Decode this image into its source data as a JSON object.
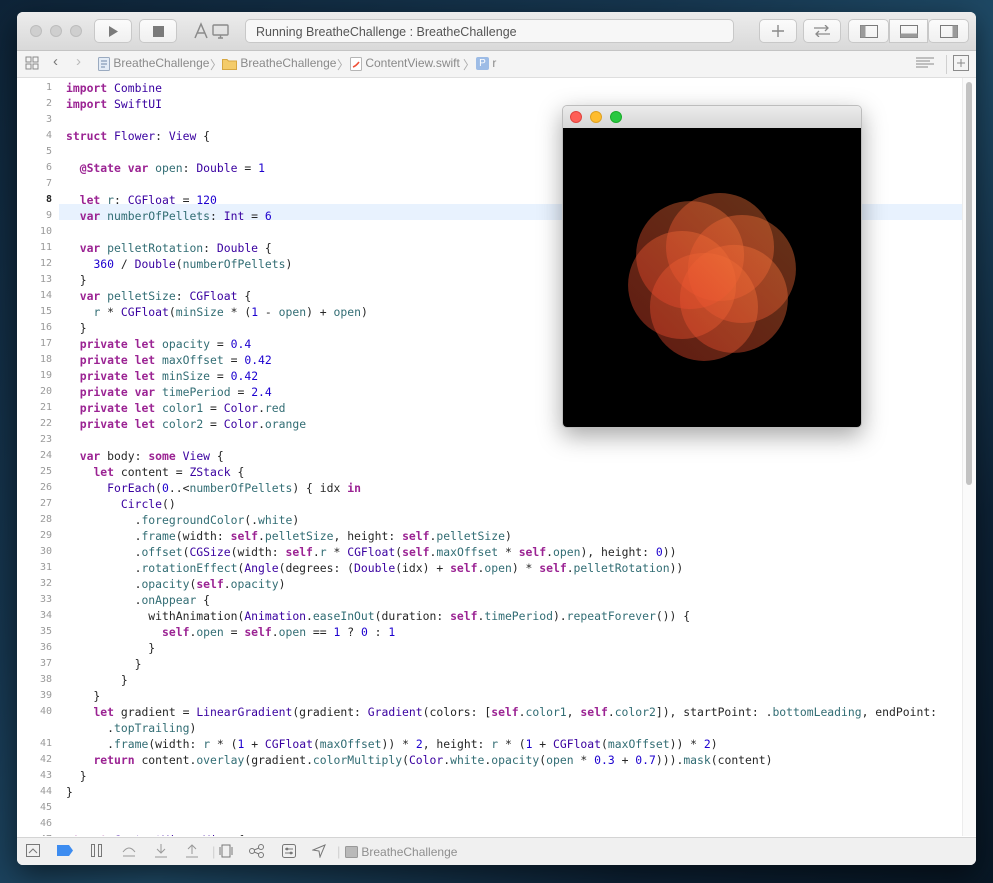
{
  "toolbar": {
    "status_text": "Running BreatheChallenge : BreatheChallenge",
    "icons": [
      "run-icon",
      "stop-icon",
      "scheme-icon",
      "library-add-icon",
      "code-review-icon",
      "navigator-toggle-icon",
      "debug-area-toggle-icon",
      "inspector-toggle-icon"
    ]
  },
  "jumpbar": {
    "crumbs": [
      "BreatheChallenge",
      "BreatheChallenge",
      "ContentView.swift",
      "r"
    ]
  },
  "editor": {
    "current_line": 8,
    "lines": [
      {
        "n": "1",
        "code": "import Combine"
      },
      {
        "n": "2",
        "code": "import SwiftUI"
      },
      {
        "n": "3",
        "code": ""
      },
      {
        "n": "4",
        "code": "struct Flower: View {"
      },
      {
        "n": "5",
        "code": ""
      },
      {
        "n": "6",
        "code": "  @State var open: Double = 1"
      },
      {
        "n": "7",
        "code": ""
      },
      {
        "n": "8",
        "code": "  let r: CGFloat = 120"
      },
      {
        "n": "9",
        "code": "  var numberOfPellets: Int = 6"
      },
      {
        "n": "10",
        "code": ""
      },
      {
        "n": "11",
        "code": "  var pelletRotation: Double {"
      },
      {
        "n": "12",
        "code": "    360 / Double(numberOfPellets)"
      },
      {
        "n": "13",
        "code": "  }"
      },
      {
        "n": "14",
        "code": "  var pelletSize: CGFloat {"
      },
      {
        "n": "15",
        "code": "    r * CGFloat(minSize * (1 - open) + open)"
      },
      {
        "n": "16",
        "code": "  }"
      },
      {
        "n": "17",
        "code": "  private let opacity = 0.4"
      },
      {
        "n": "18",
        "code": "  private let maxOffset = 0.42"
      },
      {
        "n": "19",
        "code": "  private let minSize = 0.42"
      },
      {
        "n": "20",
        "code": "  private var timePeriod = 2.4"
      },
      {
        "n": "21",
        "code": "  private let color1 = Color.red"
      },
      {
        "n": "22",
        "code": "  private let color2 = Color.orange"
      },
      {
        "n": "23",
        "code": ""
      },
      {
        "n": "24",
        "code": "  var body: some View {"
      },
      {
        "n": "25",
        "code": "    let content = ZStack {"
      },
      {
        "n": "26",
        "code": "      ForEach(0..<numberOfPellets) { idx in"
      },
      {
        "n": "27",
        "code": "        Circle()"
      },
      {
        "n": "28",
        "code": "          .foregroundColor(.white)"
      },
      {
        "n": "29",
        "code": "          .frame(width: self.pelletSize, height: self.pelletSize)"
      },
      {
        "n": "30",
        "code": "          .offset(CGSize(width: self.r * CGFloat(self.maxOffset * self.open), height: 0))"
      },
      {
        "n": "31",
        "code": "          .rotationEffect(Angle(degrees: (Double(idx) + self.open) * self.pelletRotation))"
      },
      {
        "n": "32",
        "code": "          .opacity(self.opacity)"
      },
      {
        "n": "33",
        "code": "          .onAppear {"
      },
      {
        "n": "34",
        "code": "            withAnimation(Animation.easeInOut(duration: self.timePeriod).repeatForever()) {"
      },
      {
        "n": "35",
        "code": "              self.open = self.open == 1 ? 0 : 1"
      },
      {
        "n": "36",
        "code": "            }"
      },
      {
        "n": "37",
        "code": "          }"
      },
      {
        "n": "38",
        "code": "        }"
      },
      {
        "n": "39",
        "code": "    }"
      },
      {
        "n": "40",
        "code": "    let gradient = LinearGradient(gradient: Gradient(colors: [self.color1, self.color2]), startPoint: .bottomLeading, endPoint:"
      },
      {
        "n": "",
        "code": "      .topTrailing)"
      },
      {
        "n": "41",
        "code": "      .frame(width: r * (1 + CGFloat(maxOffset)) * 2, height: r * (1 + CGFloat(maxOffset)) * 2)"
      },
      {
        "n": "42",
        "code": "    return content.overlay(gradient.colorMultiply(Color.white.opacity(open * 0.3 + 0.7))).mask(content)"
      },
      {
        "n": "43",
        "code": "  }"
      },
      {
        "n": "44",
        "code": "}"
      },
      {
        "n": "45",
        "code": ""
      },
      {
        "n": "46",
        "code": ""
      },
      {
        "n": "47",
        "code": "struct ContentView: View {"
      }
    ]
  },
  "debugbar": {
    "target_label": "BreatheChallenge"
  },
  "simulator": {
    "petal_count": 6,
    "colors": {
      "petal_red": "#e8402a",
      "petal_orange": "#f47a3a",
      "background": "#000000"
    }
  },
  "colors": {
    "keyword": "#9b2393",
    "type": "#3900a0",
    "number": "#1c00cf",
    "property": "#326d74",
    "current_line": "#e8f2fe"
  }
}
